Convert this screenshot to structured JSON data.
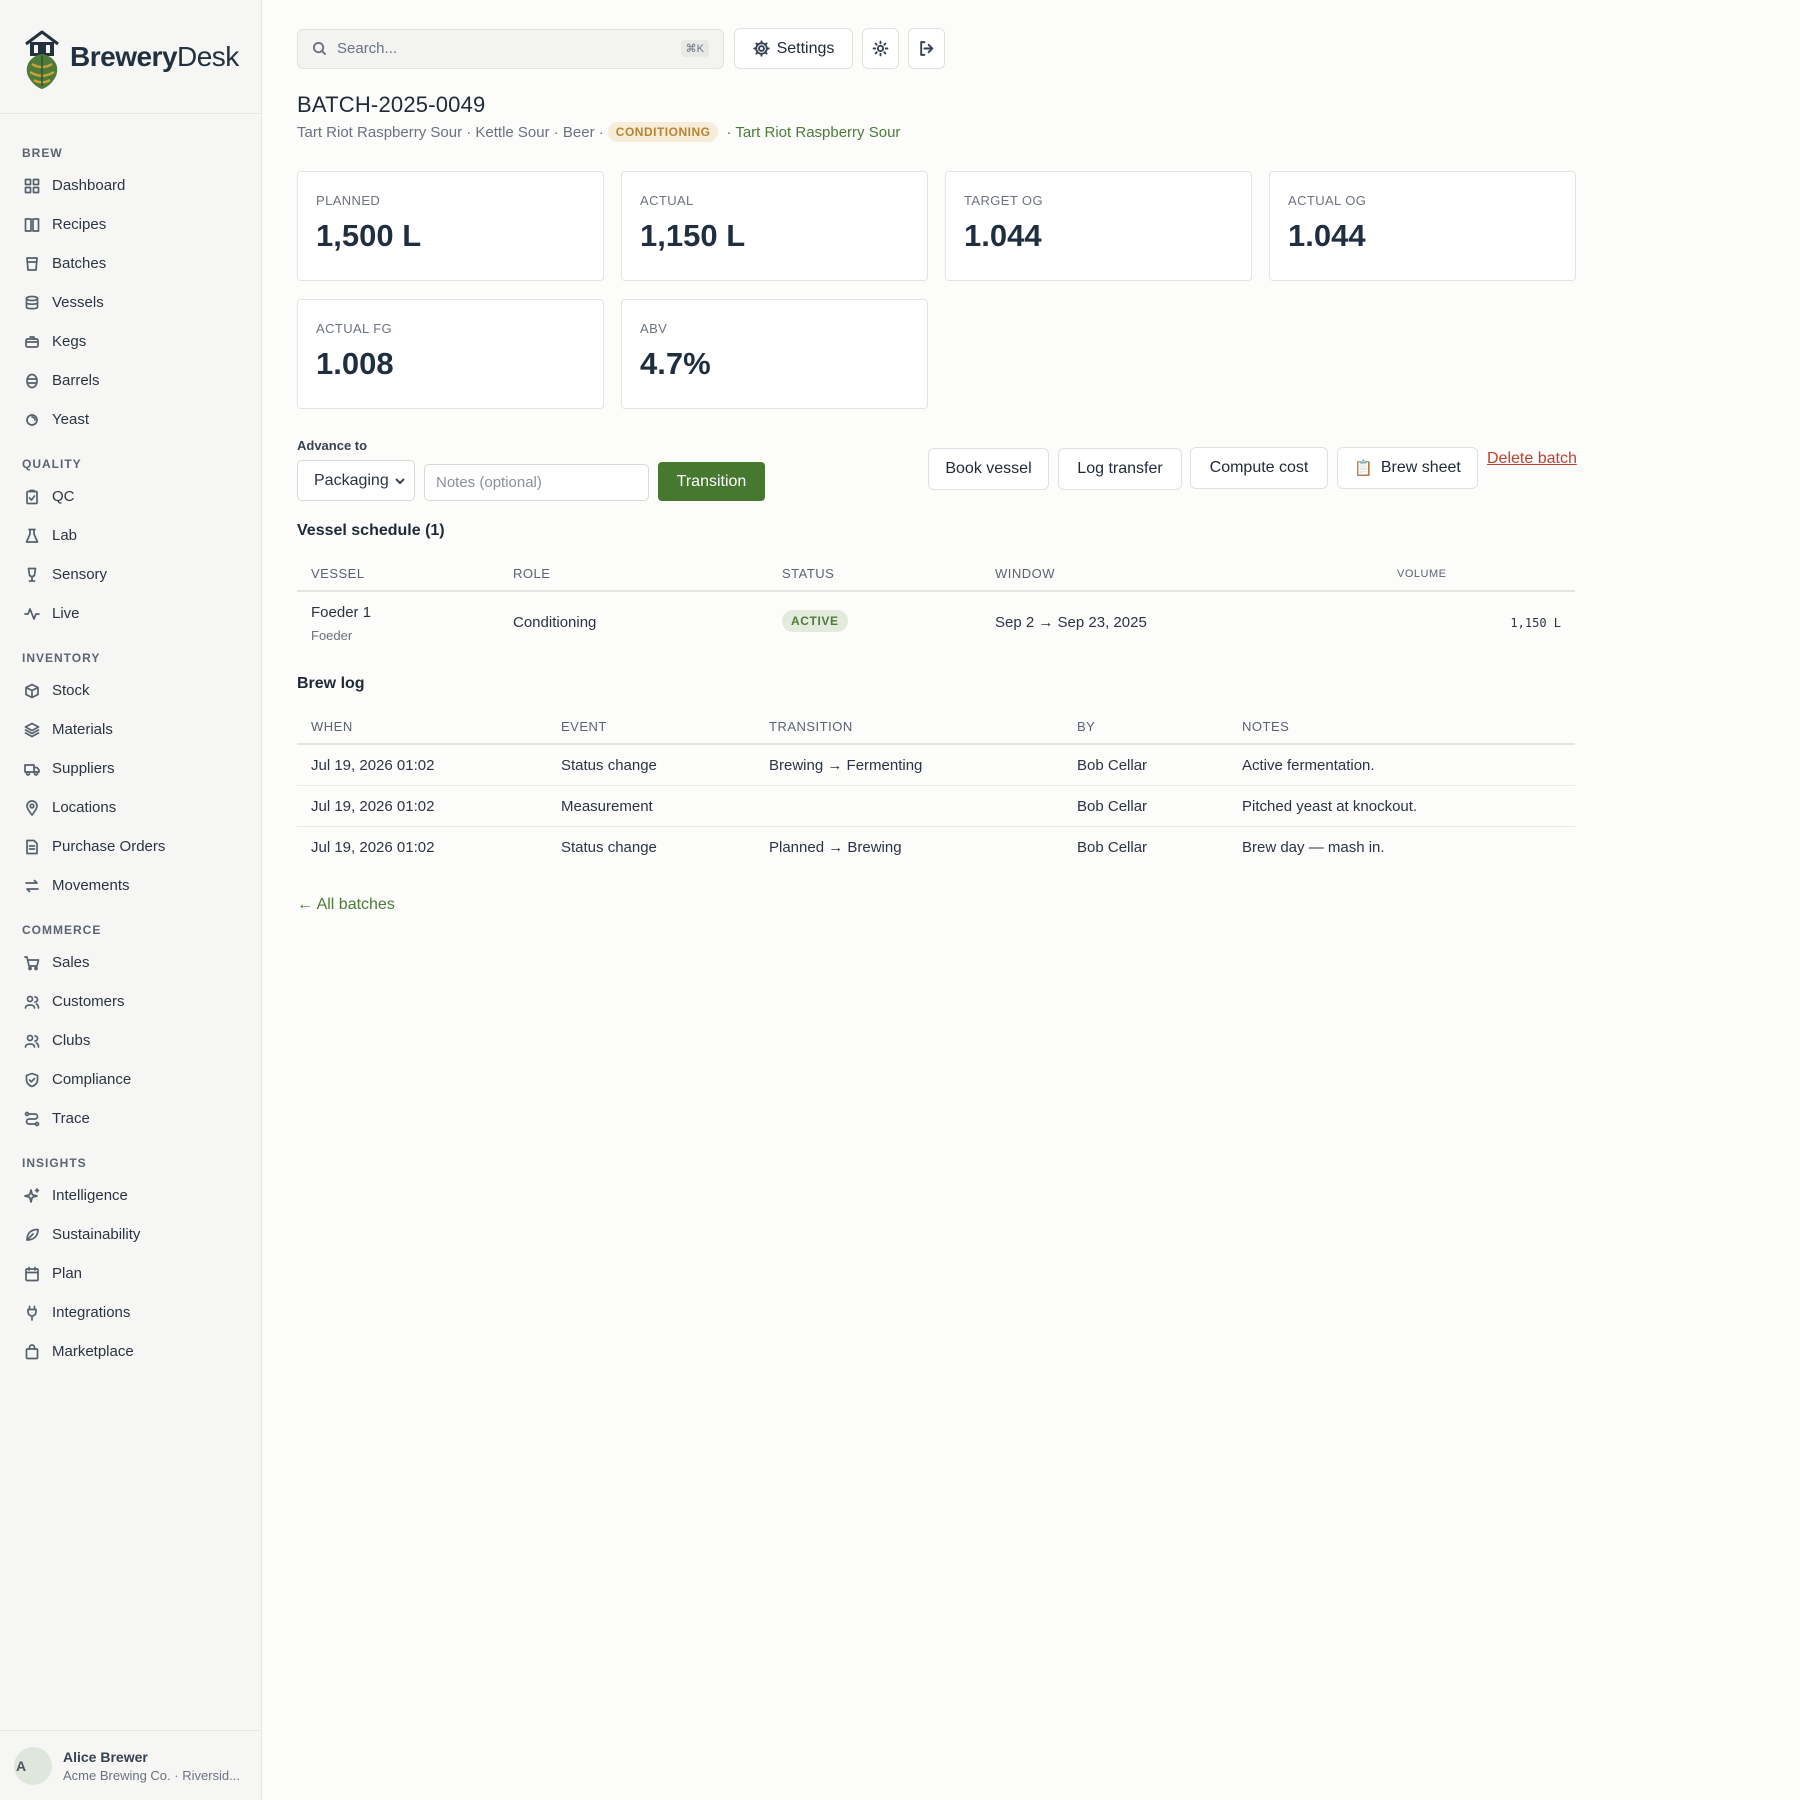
{
  "brand": {
    "name_bold": "Brewery",
    "name_light": "Desk"
  },
  "sidebar": {
    "sections": [
      {
        "title": "BREW",
        "items": [
          {
            "label": "Dashboard",
            "icon": "grid-icon"
          },
          {
            "label": "Recipes",
            "icon": "book-icon"
          },
          {
            "label": "Batches",
            "icon": "beaker-icon"
          },
          {
            "label": "Vessels",
            "icon": "database-icon"
          },
          {
            "label": "Kegs",
            "icon": "keg-icon"
          },
          {
            "label": "Barrels",
            "icon": "barrel-icon"
          },
          {
            "label": "Yeast",
            "icon": "yeast-icon"
          }
        ]
      },
      {
        "title": "QUALITY",
        "items": [
          {
            "label": "QC",
            "icon": "clipboard-check-icon"
          },
          {
            "label": "Lab",
            "icon": "flask-icon"
          },
          {
            "label": "Sensory",
            "icon": "glass-icon"
          },
          {
            "label": "Live",
            "icon": "activity-icon"
          }
        ]
      },
      {
        "title": "INVENTORY",
        "items": [
          {
            "label": "Stock",
            "icon": "package-icon"
          },
          {
            "label": "Materials",
            "icon": "layers-icon"
          },
          {
            "label": "Suppliers",
            "icon": "truck-icon"
          },
          {
            "label": "Locations",
            "icon": "map-pin-icon"
          },
          {
            "label": "Purchase Orders",
            "icon": "file-icon"
          },
          {
            "label": "Movements",
            "icon": "arrows-icon"
          }
        ]
      },
      {
        "title": "COMMERCE",
        "items": [
          {
            "label": "Sales",
            "icon": "cart-icon"
          },
          {
            "label": "Customers",
            "icon": "users-icon"
          },
          {
            "label": "Clubs",
            "icon": "users-icon"
          },
          {
            "label": "Compliance",
            "icon": "shield-icon"
          },
          {
            "label": "Trace",
            "icon": "route-icon"
          }
        ]
      },
      {
        "title": "INSIGHTS",
        "items": [
          {
            "label": "Intelligence",
            "icon": "sparkles-icon"
          },
          {
            "label": "Sustainability",
            "icon": "leaf-icon"
          },
          {
            "label": "Plan",
            "icon": "calendar-icon"
          },
          {
            "label": "Integrations",
            "icon": "plug-icon"
          },
          {
            "label": "Marketplace",
            "icon": "bag-icon"
          }
        ]
      }
    ]
  },
  "user": {
    "initial": "A",
    "name": "Alice Brewer",
    "org": "Acme Brewing Co. · Riversid..."
  },
  "topbar": {
    "search_placeholder": "Search...",
    "shortcut": "⌘K",
    "settings_label": "Settings"
  },
  "batch": {
    "code": "BATCH-2025-0049",
    "meta": "Tart Riot Raspberry Sour · Kettle Sour · Beer ·",
    "status": "CONDITIONING",
    "recipe_link": "· Tart Riot Raspberry Sour"
  },
  "stats": [
    {
      "label": "PLANNED",
      "value": "1,500 L"
    },
    {
      "label": "ACTUAL",
      "value": "1,150 L"
    },
    {
      "label": "TARGET OG",
      "value": "1.044"
    },
    {
      "label": "ACTUAL OG",
      "value": "1.044"
    },
    {
      "label": "ACTUAL FG",
      "value": "1.008"
    },
    {
      "label": "ABV",
      "value": "4.7%"
    }
  ],
  "actions": {
    "advance_label": "Advance to",
    "advance_selected": "Packaging",
    "notes_placeholder": "Notes (optional)",
    "transition_label": "Transition",
    "book_vessel": "Book vessel",
    "log_transfer": "Log transfer",
    "compute_cost": "Compute cost",
    "brew_sheet": "Brew sheet",
    "brew_sheet_emoji": "📋",
    "delete_batch": "Delete batch"
  },
  "vessel_schedule": {
    "title": "Vessel schedule (1)",
    "columns": [
      "VESSEL",
      "ROLE",
      "STATUS",
      "WINDOW",
      "VOLUME"
    ],
    "rows": [
      {
        "vessel": "Foeder 1",
        "vessel_type": "Foeder",
        "role": "Conditioning",
        "status": "ACTIVE",
        "window": "Sep 2 → Sep 23, 2025",
        "volume": "1,150 L"
      }
    ]
  },
  "brew_log": {
    "title": "Brew log",
    "columns": [
      "WHEN",
      "EVENT",
      "TRANSITION",
      "BY",
      "NOTES"
    ],
    "rows": [
      {
        "when": "Jul 19, 2026 01:02",
        "event": "Status change",
        "transition": "Brewing → Fermenting",
        "by": "Bob Cellar",
        "notes": "Active fermentation."
      },
      {
        "when": "Jul 19, 2026 01:02",
        "event": "Measurement",
        "transition": "",
        "by": "Bob Cellar",
        "notes": "Pitched yeast at knockout."
      },
      {
        "when": "Jul 19, 2026 01:02",
        "event": "Status change",
        "transition": "Planned → Brewing",
        "by": "Bob Cellar",
        "notes": "Brew day — mash in."
      }
    ]
  },
  "footer_link": "← All batches",
  "colors": {
    "accent": "#46782f",
    "danger": "#c2402f",
    "warning_badge": "#b58532"
  }
}
